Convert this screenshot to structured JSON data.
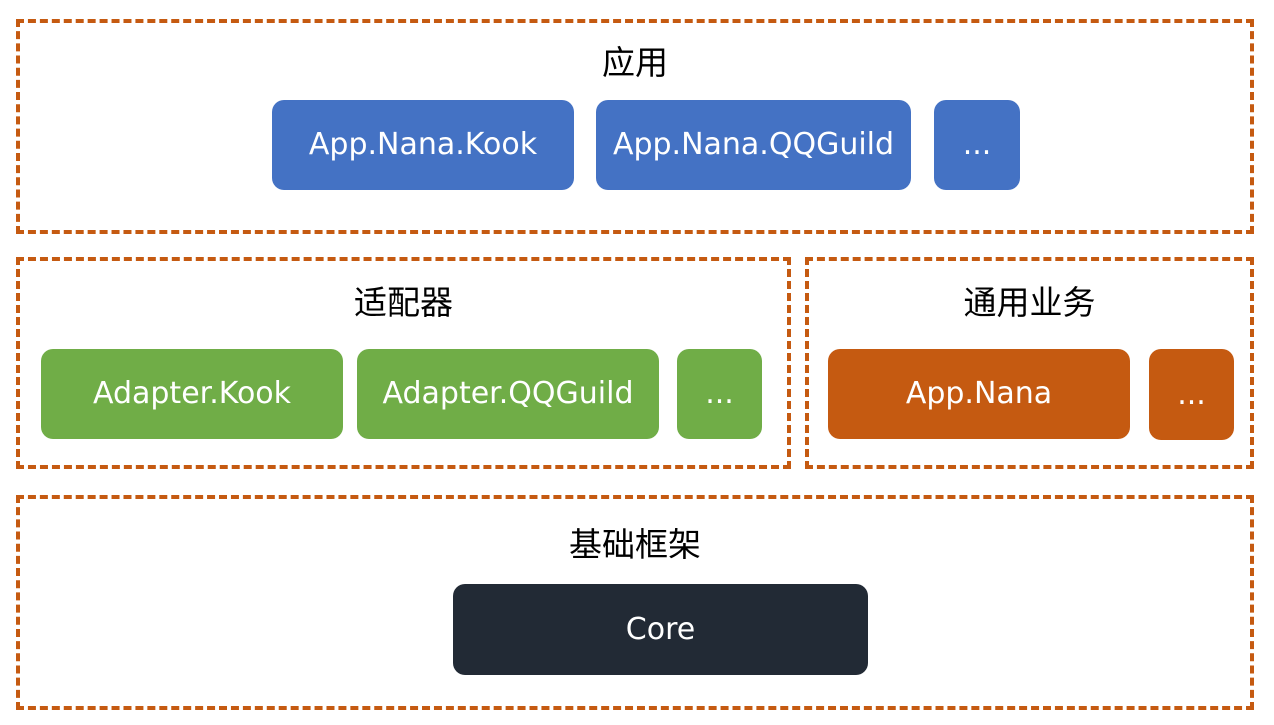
{
  "colors": {
    "border": "#c55a11",
    "app": "#4472c4",
    "adapter": "#70ad47",
    "business": "#c55a11",
    "core": "#222a35"
  },
  "layers": {
    "app": {
      "title": "应用",
      "items": [
        "App.Nana.Kook",
        "App.Nana.QQGuild",
        "..."
      ]
    },
    "adapter": {
      "title": "适配器",
      "items": [
        "Adapter.Kook",
        "Adapter.QQGuild",
        "..."
      ]
    },
    "business": {
      "title": "通用业务",
      "items": [
        "App.Nana",
        "..."
      ]
    },
    "core": {
      "title": "基础框架",
      "items": [
        "Core"
      ]
    }
  }
}
